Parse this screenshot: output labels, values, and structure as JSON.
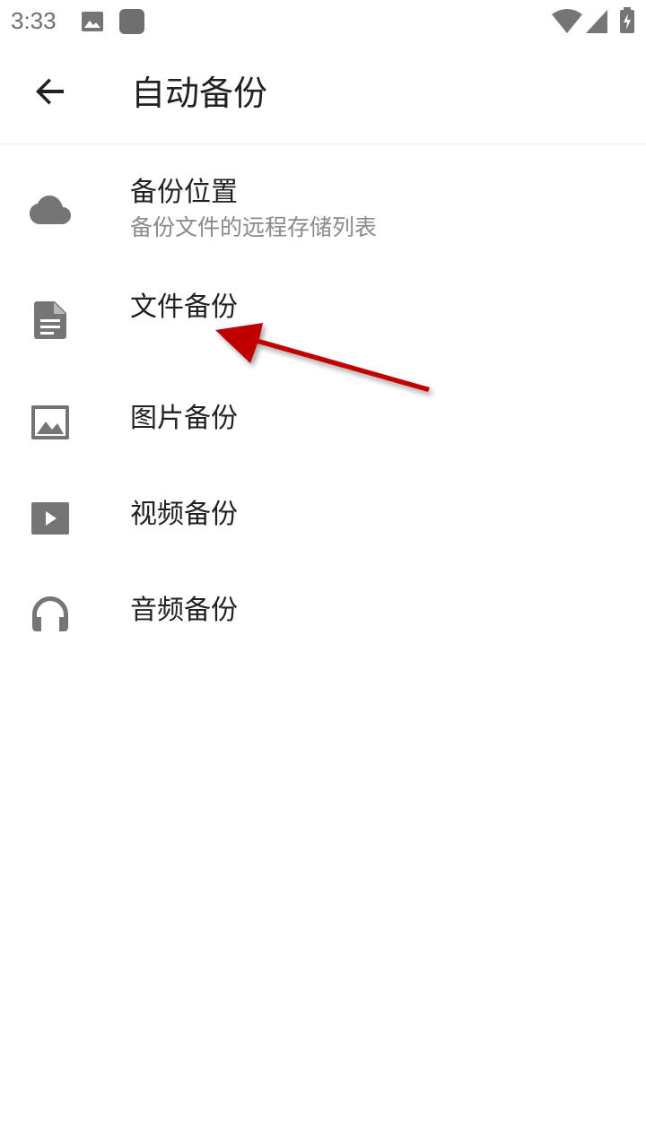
{
  "status_bar": {
    "time": "3:33",
    "icons": [
      "image-notification-icon",
      "app-notification-icon",
      "wifi-icon",
      "cellular-signal-icon",
      "battery-charging-icon"
    ]
  },
  "app_bar": {
    "title": "自动备份",
    "back_icon": "arrow-back-icon"
  },
  "list": {
    "items": [
      {
        "icon": "cloud-icon",
        "title": "备份位置",
        "subtitle": "备份文件的远程存储列表"
      },
      {
        "icon": "document-icon",
        "title": "文件备份"
      },
      {
        "icon": "image-icon",
        "title": "图片备份"
      },
      {
        "icon": "video-play-icon",
        "title": "视频备份"
      },
      {
        "icon": "headphones-icon",
        "title": "音频备份"
      }
    ]
  },
  "colors": {
    "icon_gray": "#757575",
    "title_text": "#212121",
    "subtitle_text": "#8a8a8a",
    "annotation_arrow": "#c00000"
  }
}
